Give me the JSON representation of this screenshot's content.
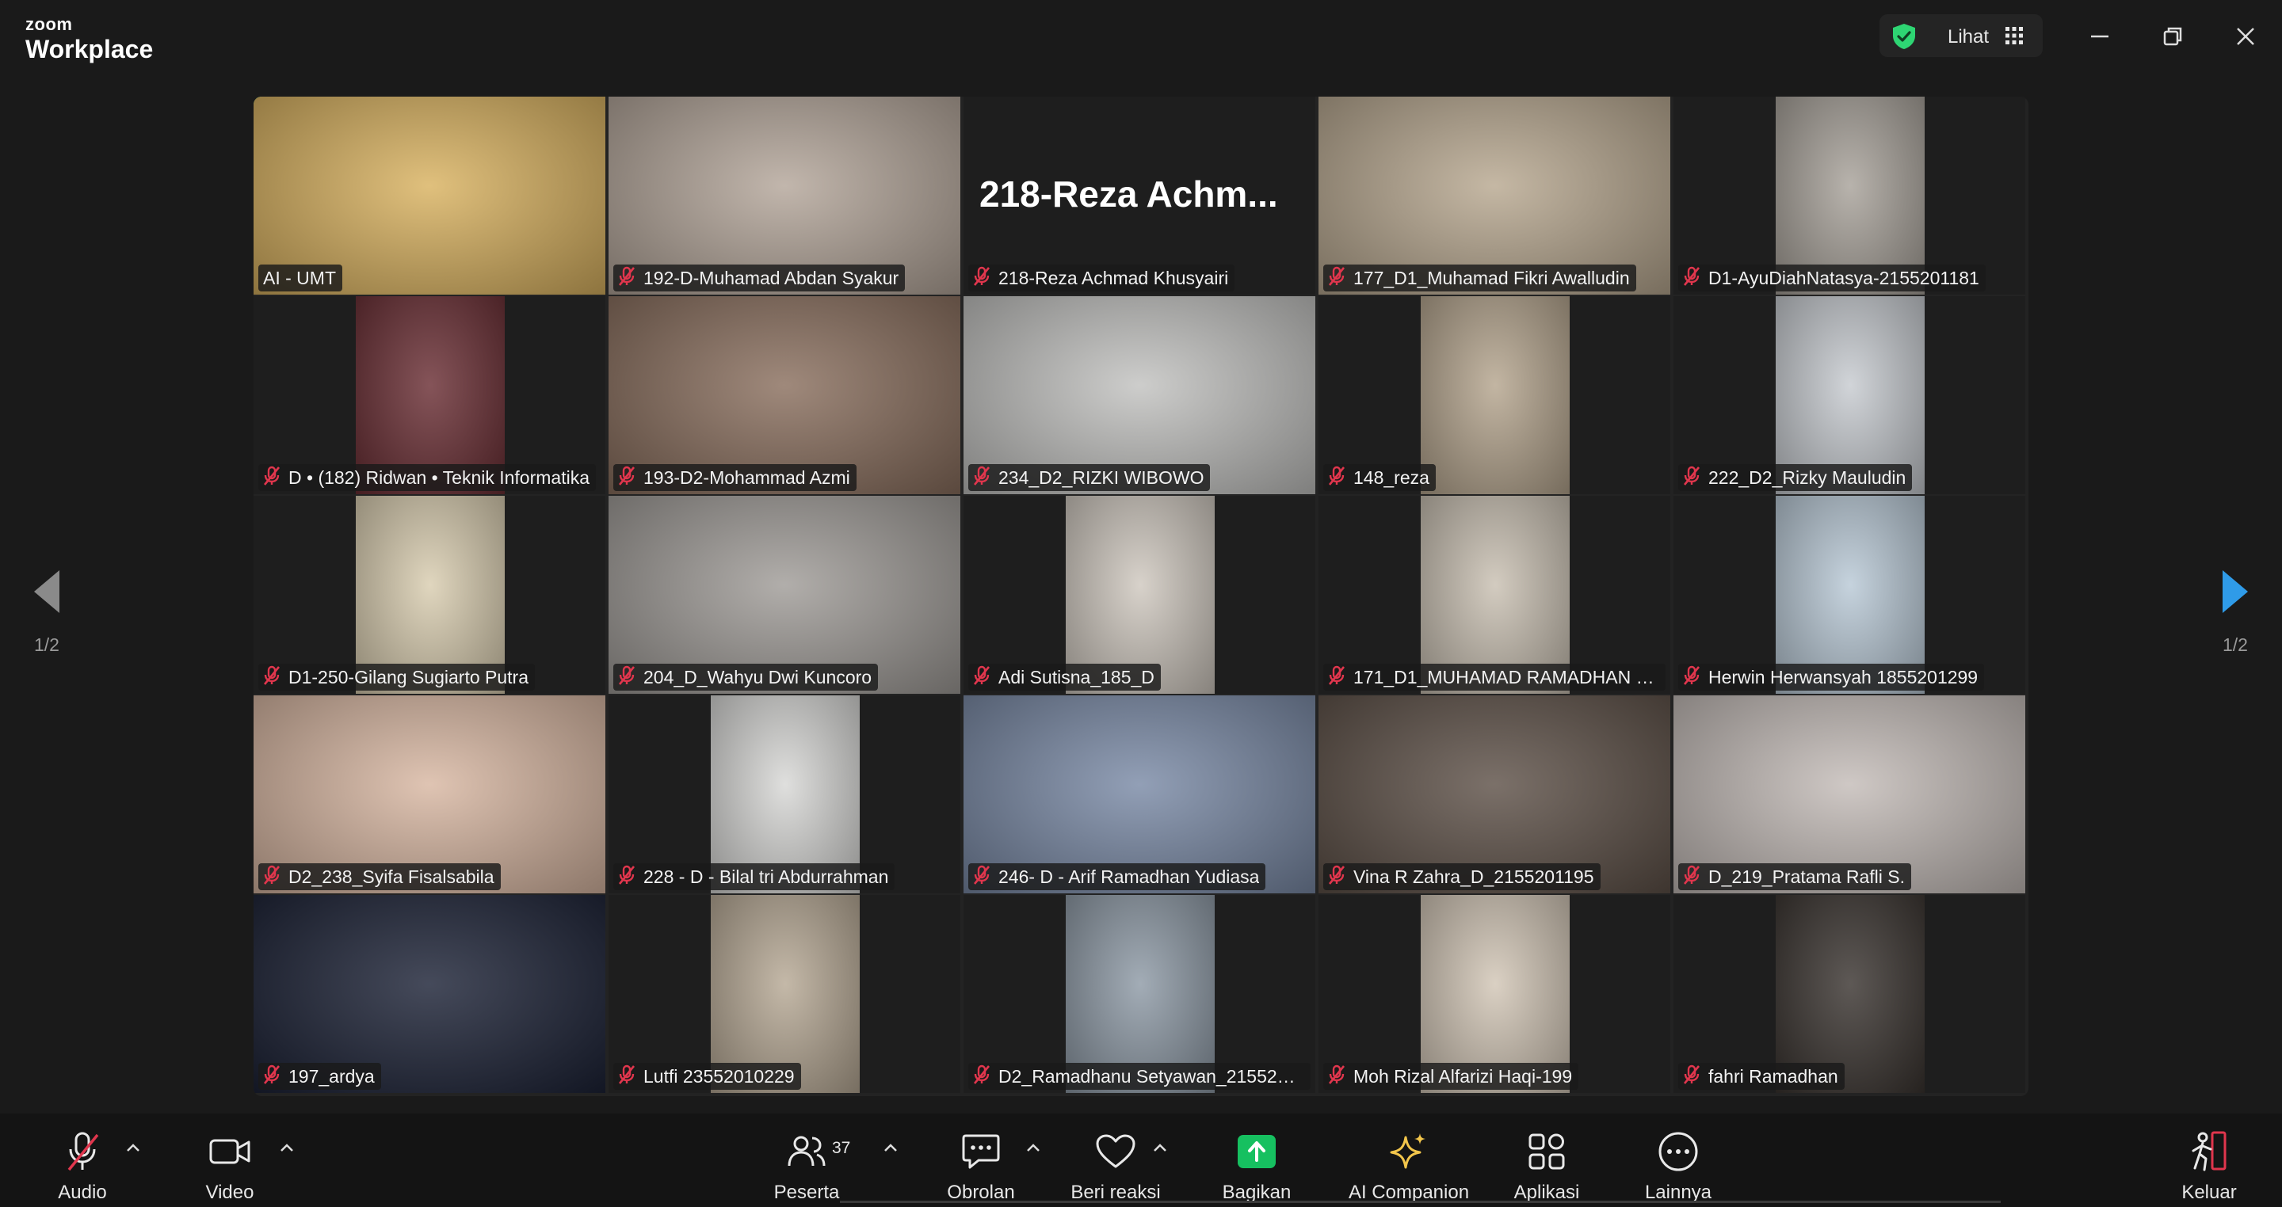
{
  "app": {
    "logo_top": "zoom",
    "logo_bottom": "Workplace",
    "view_label": "Lihat"
  },
  "participants": [
    {
      "name": "AI - UMT",
      "muted": false,
      "active": true,
      "bg": "#d9b260",
      "frame": "full"
    },
    {
      "name": "192-D-Muhamad Abdan Syakur",
      "muted": true,
      "bg": "#b4a69a",
      "frame": "full"
    },
    {
      "name": "218-Reza Achmad Khusyairi",
      "muted": true,
      "bg": "#1e1e1e",
      "frame": "none",
      "big_name": "218-Reza  Achm..."
    },
    {
      "name": "177_D1_Muhamad Fikri Awalludin",
      "muted": true,
      "bg": "#b8a890",
      "frame": "full"
    },
    {
      "name": "D1-AyuDiahNatasya-2155201181",
      "muted": true,
      "bg": "#a8a29a",
      "frame": "mid"
    },
    {
      "name": "D • (182) Ridwan • Teknik Informatika",
      "muted": true,
      "bg": "#6a2e34",
      "frame": "mid"
    },
    {
      "name": "193-D2-Mohammad Azmi",
      "muted": true,
      "bg": "#8a6f5e",
      "frame": "full"
    },
    {
      "name": "234_D2_RIZKI WIBOWO",
      "muted": true,
      "bg": "#c2c2c0",
      "frame": "full"
    },
    {
      "name": "148_reza",
      "muted": true,
      "bg": "#b5a58e",
      "frame": "mid"
    },
    {
      "name": "222_D2_Rizky Mauludin",
      "muted": true,
      "bg": "#c7cbd0",
      "frame": "mid"
    },
    {
      "name": "D1-250-Gilang Sugiarto Putra",
      "muted": true,
      "bg": "#d9cdb0",
      "frame": "mid"
    },
    {
      "name": "204_D_Wahyu Dwi Kuncoro",
      "muted": true,
      "bg": "#a09c98",
      "frame": "full"
    },
    {
      "name": "Adi Sutisna_185_D",
      "muted": true,
      "bg": "#cfc8bf",
      "frame": "mid"
    },
    {
      "name": "171_D1_MUHAMAD RAMADHAN D...",
      "muted": true,
      "bg": "#c9c0b2",
      "frame": "mid"
    },
    {
      "name": "Herwin Herwansyah 1855201299",
      "muted": true,
      "bg": "#b9c9d6",
      "frame": "mid"
    },
    {
      "name": "D2_238_Syifa Fisalsabila",
      "muted": true,
      "bg": "#d8b7a2",
      "frame": "full"
    },
    {
      "name": "228 - D - Bilal tri Abdurrahman",
      "muted": true,
      "bg": "#d8d8d6",
      "frame": "mid"
    },
    {
      "name": "246- D - Arif Ramadhan Yudiasa",
      "muted": true,
      "bg": "#7a8aa6",
      "frame": "full"
    },
    {
      "name": "Vina R Zahra_D_2155201195",
      "muted": true,
      "bg": "#5e5148",
      "frame": "full"
    },
    {
      "name": "D_219_Pratama Rafli S.",
      "muted": true,
      "bg": "#c4bcb8",
      "frame": "full"
    },
    {
      "name": "197_ardya",
      "muted": true,
      "bg": "#1c2236",
      "frame": "full"
    },
    {
      "name": "Lutfi 23552010229",
      "muted": true,
      "bg": "#b7a995",
      "frame": "mid"
    },
    {
      "name": "D2_Ramadhanu Setyawan_2155201...",
      "muted": true,
      "bg": "#8e9aa6",
      "frame": "mid"
    },
    {
      "name": "Moh Rizal Alfarizi Haqi-199",
      "muted": true,
      "bg": "#d2c6b6",
      "frame": "mid"
    },
    {
      "name": "fahri Ramadhan",
      "muted": true,
      "bg": "#3a3430",
      "frame": "mid"
    }
  ],
  "pager": {
    "left_label": "1/2",
    "right_label": "1/2"
  },
  "toolbar": {
    "audio": "Audio",
    "video": "Video",
    "participants": "Peserta",
    "participants_count": "37",
    "chat": "Obrolan",
    "reactions": "Beri reaksi",
    "share": "Bagikan",
    "ai_companion": "AI Companion",
    "apps": "Aplikasi",
    "more": "Lainnya",
    "leave": "Keluar"
  },
  "colors": {
    "accent_green": "#2ed573",
    "share_green": "#16c060",
    "mute_red": "#e0364d",
    "pager_blue": "#2f9be8",
    "ai_gold": "#f3c64b"
  }
}
